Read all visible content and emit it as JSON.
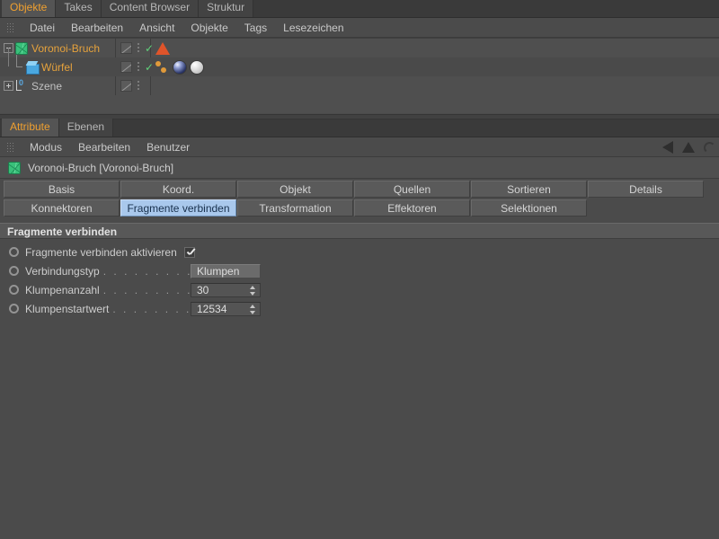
{
  "object_manager": {
    "tabs": [
      {
        "label": "Objekte",
        "active": true
      },
      {
        "label": "Takes",
        "active": false
      },
      {
        "label": "Content Browser",
        "active": false
      },
      {
        "label": "Struktur",
        "active": false
      }
    ],
    "menu": [
      "Datei",
      "Bearbeiten",
      "Ansicht",
      "Objekte",
      "Tags",
      "Lesezeichen"
    ],
    "rows": [
      {
        "name": "Voronoi-Bruch",
        "name_color": "#e6a23c",
        "icon": "voronoi-fracture-icon",
        "depth": 0,
        "expander": "minus",
        "visible_check": true,
        "tags": [
          "simulation-tag-triangle-icon"
        ]
      },
      {
        "name": "Würfel",
        "name_color": "#e6a23c",
        "icon": "cube-icon",
        "depth": 1,
        "expander": "none",
        "visible_check": true,
        "tags": [
          "point-tag-icon",
          "material-tag-blue-icon",
          "material-tag-white-icon"
        ]
      },
      {
        "name": "Szene",
        "name_color": "#c2c2c2",
        "icon": "scene-layer-icon",
        "depth": 0,
        "expander": "plus",
        "visible_check": false,
        "tags": []
      }
    ]
  },
  "attribute_manager": {
    "tabs": [
      {
        "label": "Attribute",
        "active": true
      },
      {
        "label": "Ebenen",
        "active": false
      }
    ],
    "menu": [
      "Modus",
      "Bearbeiten",
      "Benutzer"
    ],
    "object_line": "Voronoi-Bruch [Voronoi-Bruch]",
    "object_icon": "voronoi-fracture-icon",
    "param_tabs_row1": [
      {
        "label": "Basis",
        "selected": false
      },
      {
        "label": "Koord.",
        "selected": false
      },
      {
        "label": "Objekt",
        "selected": false
      },
      {
        "label": "Quellen",
        "selected": false
      },
      {
        "label": "Sortieren",
        "selected": false
      },
      {
        "label": "Details",
        "selected": false
      }
    ],
    "param_tabs_row2": [
      {
        "label": "Konnektoren",
        "selected": false
      },
      {
        "label": "Fragmente verbinden",
        "selected": true
      },
      {
        "label": "Transformation",
        "selected": false
      },
      {
        "label": "Effektoren",
        "selected": false
      },
      {
        "label": "Selektionen",
        "selected": false
      }
    ],
    "section_title": "Fragmente verbinden",
    "params": [
      {
        "label": "Fragmente verbinden aktivieren",
        "type": "checkbox",
        "checked": true,
        "dots": ""
      },
      {
        "label": "Verbindungstyp",
        "type": "combo",
        "value": "Klumpen",
        "dots": ". . . . . . . . . . . . ."
      },
      {
        "label": "Klumpenanzahl",
        "type": "number",
        "value": "30",
        "dots": ". . . . . . . . . . . . . ."
      },
      {
        "label": "Klumpenstartwert",
        "type": "number",
        "value": "12534",
        "dots": ". . . . . . . . . . ."
      }
    ],
    "nav_icons": [
      "back-arrow-icon",
      "up-arrow-icon",
      "history-icon"
    ]
  },
  "colors": {
    "accent_orange": "#f0a030",
    "selection_blue": "#a9c8ec",
    "panel_bg": "#4b4b4b",
    "check_green": "#5fd07a"
  }
}
